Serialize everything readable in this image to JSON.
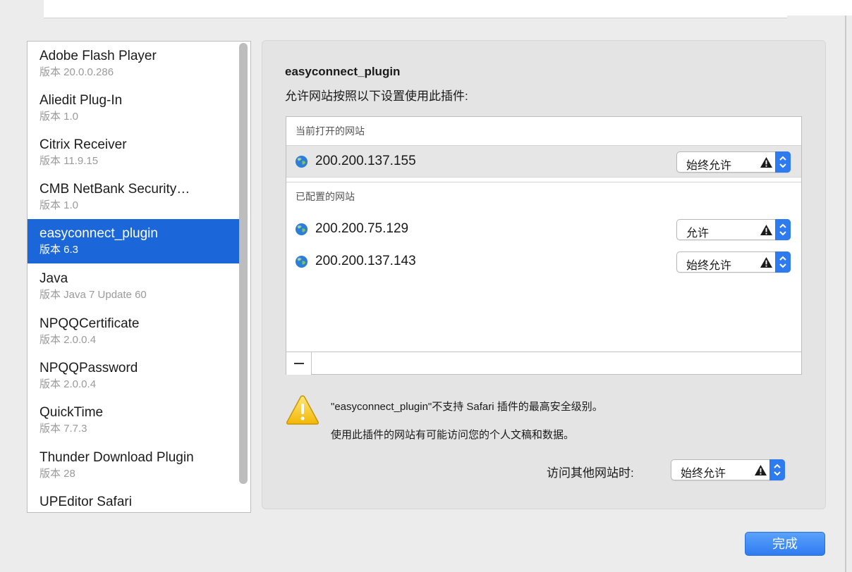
{
  "plugins": [
    {
      "name": "Adobe Flash Player",
      "version": "版本 20.0.0.286"
    },
    {
      "name": "Aliedit Plug-In",
      "version": "版本 1.0"
    },
    {
      "name": "Citrix Receiver",
      "version": "版本 11.9.15"
    },
    {
      "name": "CMB NetBank Security…",
      "version": "版本 1.0"
    },
    {
      "name": "easyconnect_plugin",
      "version": "版本 6.3"
    },
    {
      "name": "Java",
      "version": "版本 Java 7 Update 60"
    },
    {
      "name": "NPQQCertificate",
      "version": "版本 2.0.0.4"
    },
    {
      "name": "NPQQPassword",
      "version": "版本 2.0.0.4"
    },
    {
      "name": "QuickTime",
      "version": "版本 7.7.3"
    },
    {
      "name": "Thunder Download Plugin",
      "version": "版本 28"
    },
    {
      "name": "UPEditor Safari",
      "version": ""
    }
  ],
  "selected_plugin": "easyconnect_plugin",
  "detail": {
    "title": "easyconnect_plugin",
    "description": "允许网站按照以下设置使用此插件:",
    "open_sites_label": "当前打开的网站",
    "configured_sites_label": "已配置的网站",
    "open_sites": [
      {
        "url": "200.200.137.155",
        "policy": "始终允许"
      }
    ],
    "configured_sites": [
      {
        "url": "200.200.75.129",
        "policy": "允许"
      },
      {
        "url": "200.200.137.143",
        "policy": "始终允许"
      }
    ],
    "remove_label": "—",
    "warning_line1": "\"easyconnect_plugin\"不支持 Safari 插件的最高安全级别。",
    "warning_line2": "使用此插件的网站有可能访问您的个人文稿和数据。",
    "other_sites_label": "访问其他网站时:",
    "other_sites_policy": "始终允许"
  },
  "done_label": "完成",
  "colors": {
    "selection": "#1b67d9",
    "stepper": "#2e7bef",
    "done_button": "#2f7bf0",
    "warning_yellow": "#f5c518"
  },
  "icons": {
    "site": "globe-icon",
    "policy_warning": "warning-triangle-icon",
    "stepper": "chevron-up-down-icon",
    "alert": "alert-triangle-icon"
  }
}
